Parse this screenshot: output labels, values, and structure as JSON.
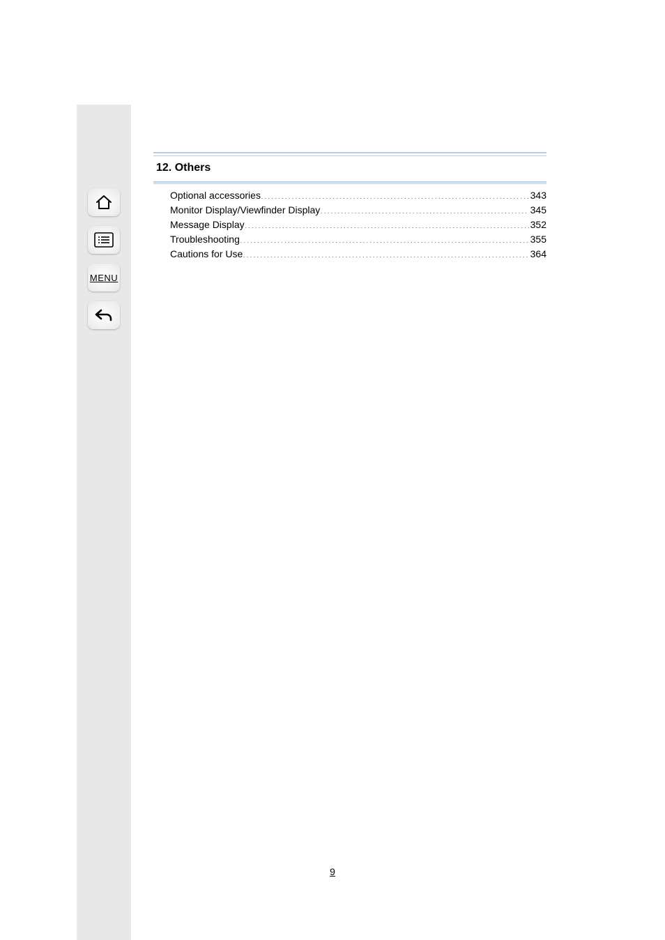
{
  "sidebar": {
    "home_name": "home-icon",
    "toc_name": "table-of-contents-icon",
    "menu_label": "MENU",
    "back_name": "back-icon"
  },
  "section": {
    "number": "12.",
    "title": "Others"
  },
  "toc": [
    {
      "label": "Optional accessories",
      "page": "343"
    },
    {
      "label": "Monitor Display/Viewfinder Display",
      "page": "345"
    },
    {
      "label": "Message Display",
      "page": "352"
    },
    {
      "label": "Troubleshooting",
      "page": "355"
    },
    {
      "label": "Cautions for Use",
      "page": "364"
    }
  ],
  "page_number": "9"
}
